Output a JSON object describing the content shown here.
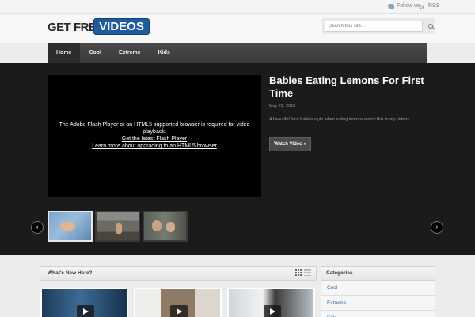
{
  "topbar": {
    "follow_label": "Follow us",
    "rss_label": "RSS",
    "follow_icon": "twitter-bird-icon",
    "rss_icon": "rss-icon"
  },
  "header": {
    "logo_left": "GET FREE",
    "logo_right": "VIDEOS",
    "search_placeholder": "Search this site...",
    "brand_color": "#1e5c9c"
  },
  "nav": {
    "items": [
      {
        "label": "Home",
        "active": true
      },
      {
        "label": "Cool"
      },
      {
        "label": "Extreme"
      },
      {
        "label": "Kids"
      }
    ]
  },
  "featured": {
    "player_message": "The Adobe Flash Player or an HTML5 supported browser is required for video playback.",
    "player_link1": "Get the latest Flash Player",
    "player_link2": "Learn more about upgrading to an HTML5 browser",
    "title": "Babies Eating Lemons For First Time",
    "date": "May 22, 2013",
    "description": "A beautiful face babies style when eating lemons watch this funny videos",
    "button_label": "Watch Video »",
    "prev_arrow": "‹",
    "next_arrow": "›"
  },
  "whats_new": {
    "title": "What's New Here?"
  },
  "categories": {
    "title": "Categories",
    "items": [
      "Cool",
      "Extreme",
      "Kids"
    ]
  }
}
